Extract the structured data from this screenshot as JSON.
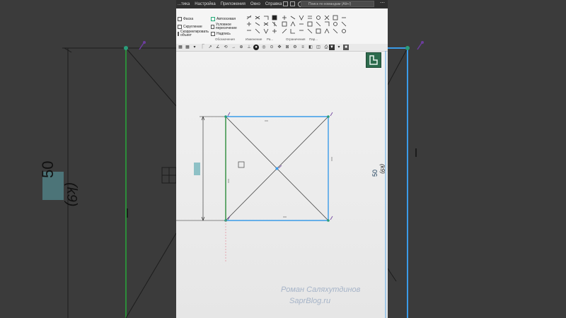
{
  "menu": {
    "items": [
      "...тика",
      "Настройка",
      "Приложения",
      "Окно",
      "Справка"
    ],
    "search_placeholder": "Поиск по командам (Alt+/)"
  },
  "ribbon": {
    "col1": [
      "Фаска",
      "Скругление",
      "Скорректировать объект"
    ],
    "col2": [
      "Автоосевая",
      "Условное пересечение",
      "Надпись"
    ],
    "groups": [
      "Обозначения",
      "Изменение",
      "Ра...",
      "Ограничения",
      "Пар..."
    ]
  },
  "drawing": {
    "dimension_value": "50",
    "dimension_suffix": "(k9)",
    "bg_dimension_value": "50",
    "bg_dimension_suffix": "(k9)"
  },
  "watermark": {
    "line1": "Роман Саляхутдинов",
    "line2": "SaprBlog.ru"
  },
  "colors": {
    "sketch_blue": "#3a9be8",
    "construction_green": "#2c8c3a",
    "dimension_highlight": "#5aa0a6",
    "constraint_purple": "#6b3d9c"
  }
}
